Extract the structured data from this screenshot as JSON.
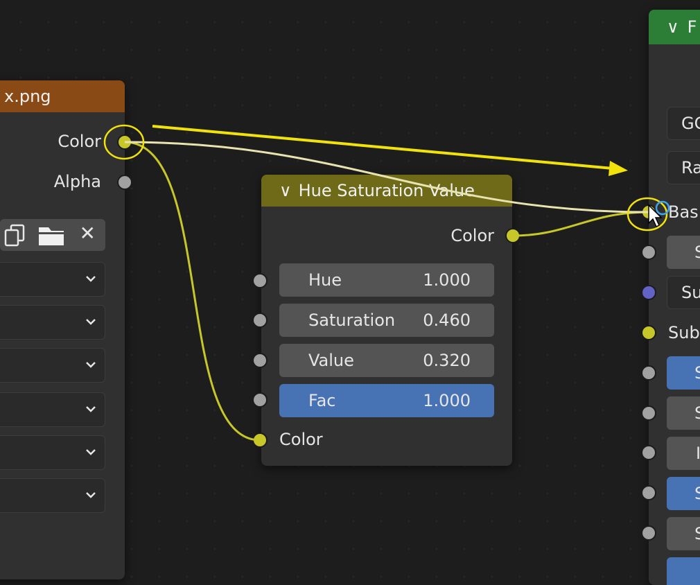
{
  "image_node": {
    "title": "x.png",
    "header_color": "#8a4a16",
    "outputs": [
      "Color",
      "Alpha"
    ],
    "button_icons": [
      "copy-icon",
      "folder-icon",
      "close-icon"
    ],
    "close_glyph": "✕"
  },
  "hsv_node": {
    "title": "Hue Saturation Value",
    "collapse_glyph": "∨",
    "header_color": "#6e6a18",
    "output": "Color",
    "fields": [
      {
        "label": "Hue",
        "value": "1.000"
      },
      {
        "label": "Saturation",
        "value": "0.460"
      },
      {
        "label": "Value",
        "value": "0.320"
      },
      {
        "label": "Fac",
        "value": "1.000"
      }
    ],
    "color_input": "Color"
  },
  "bsdf_node": {
    "title_partial": "F",
    "collapse_glyph": "∨",
    "header_color": "#2c7d35",
    "dropdown_1": "GG",
    "dropdown_2": "Ra",
    "inputs": [
      "Bas",
      "S",
      "Su",
      "Sub",
      "S",
      "S",
      "I",
      "S",
      "S"
    ]
  },
  "annotation": {
    "color": "#f0e20a"
  }
}
